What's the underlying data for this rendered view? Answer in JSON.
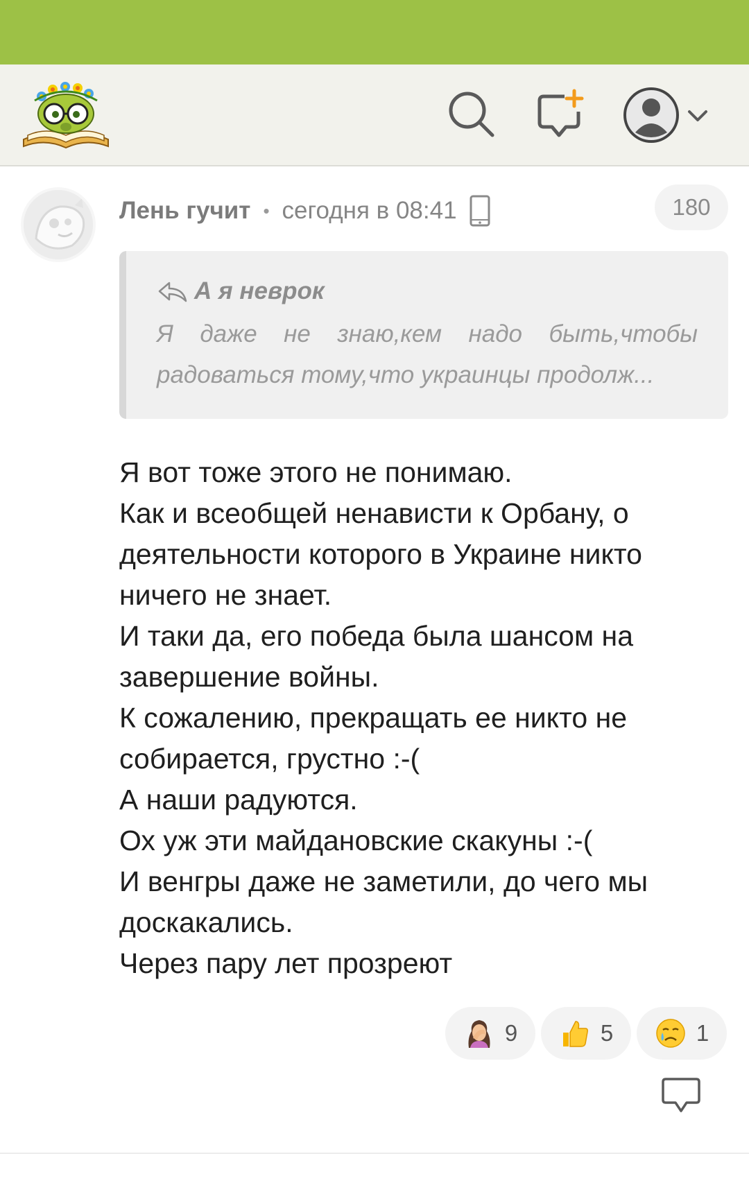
{
  "colors": {
    "status_bar": "#9dc146",
    "header_bg": "#f2f2ec",
    "accent_orange": "#f39b1b",
    "text": "#1f1f1f",
    "muted": "#858585"
  },
  "header": {
    "logo_icon": "site-logo-book-with-glasses",
    "icons": [
      "search-icon",
      "new-comment-icon",
      "user-avatar-icon",
      "chevron-down-icon"
    ]
  },
  "comment": {
    "author": "Лень гучит",
    "separator": "•",
    "time": "сегодня в 08:41",
    "device_icon": "phone-icon",
    "rating": "180",
    "quote": {
      "author": "А я неврок",
      "text": "Я даже не знаю,кем надо быть,чтобы радоваться тому,что украинцы продолж..."
    },
    "body_lines": [
      "Я вот тоже этого не понимаю.",
      "Как и всеобщей ненависти к Орбану, о",
      "деятельности которого в Украине никто",
      "ничего не знает.",
      "И таки да, его победа была шансом на",
      "завершение войны.",
      "К сожалению, прекращать ее никто не",
      "собирается, грустно :-(",
      "А наши радуются.",
      "Ох уж эти майдановские скакуны :-(",
      "И венгры даже не заметили, до чего мы",
      "доскакались.",
      "Через пару лет прозреют"
    ],
    "reactions": [
      {
        "icon": "facepalm-emoji-icon",
        "count": "9"
      },
      {
        "icon": "thumbs-up-emoji-icon",
        "count": "5"
      },
      {
        "icon": "crying-face-emoji-icon",
        "count": "1"
      }
    ]
  }
}
